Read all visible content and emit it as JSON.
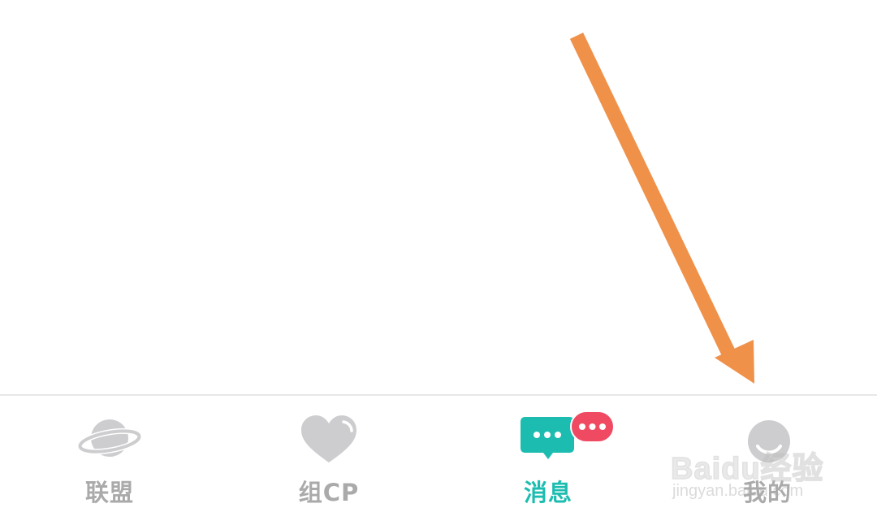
{
  "tabbar": {
    "tabs": [
      {
        "id": "alliance",
        "label": "联盟",
        "icon": "planet-icon",
        "active": false
      },
      {
        "id": "cp",
        "label": "组CP",
        "icon": "heart-icon",
        "active": false
      },
      {
        "id": "messages",
        "label": "消息",
        "icon": "chat-bubble-icon",
        "active": true
      },
      {
        "id": "mine",
        "label": "我的",
        "icon": "profile-icon",
        "active": false
      }
    ],
    "messages_badge_icon": "chat-dots-badge"
  },
  "colors": {
    "inactive": "#cdcdcf",
    "inactive_label": "#aaaaaa",
    "active": "#1cbdb0",
    "badge": "#f04a63",
    "arrow": "#f0914a"
  },
  "watermark": {
    "logo_text": "Baidu经验",
    "url": "jingyan.baidu.com"
  },
  "annotation": {
    "type": "arrow",
    "points_to": "tab-mine"
  }
}
